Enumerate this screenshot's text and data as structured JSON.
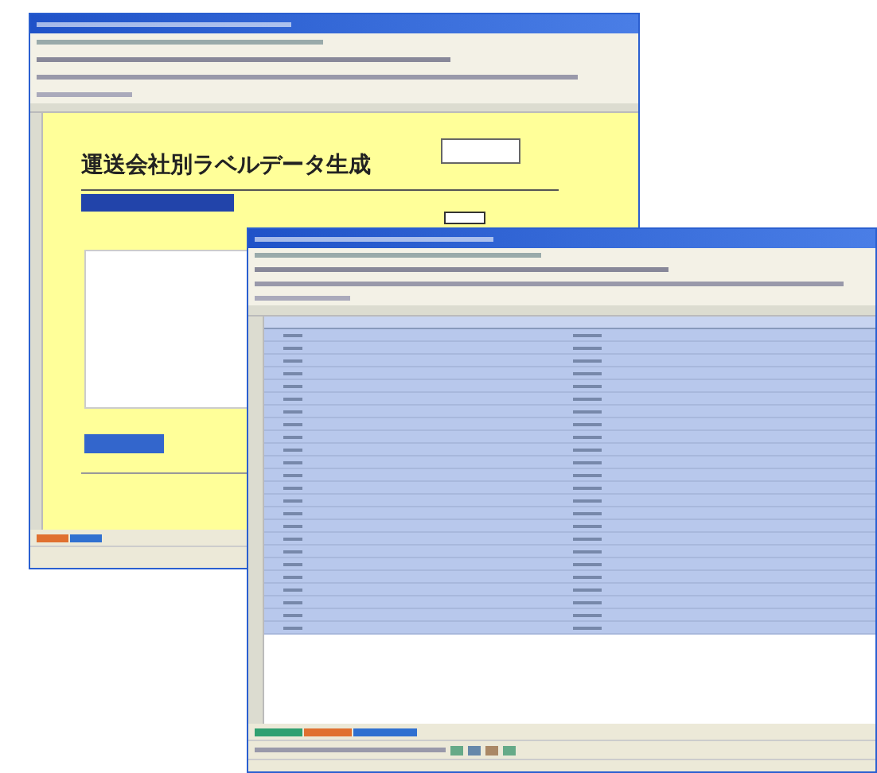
{
  "form_window": {
    "heading": "運送会社別ラベルデータ生成"
  }
}
